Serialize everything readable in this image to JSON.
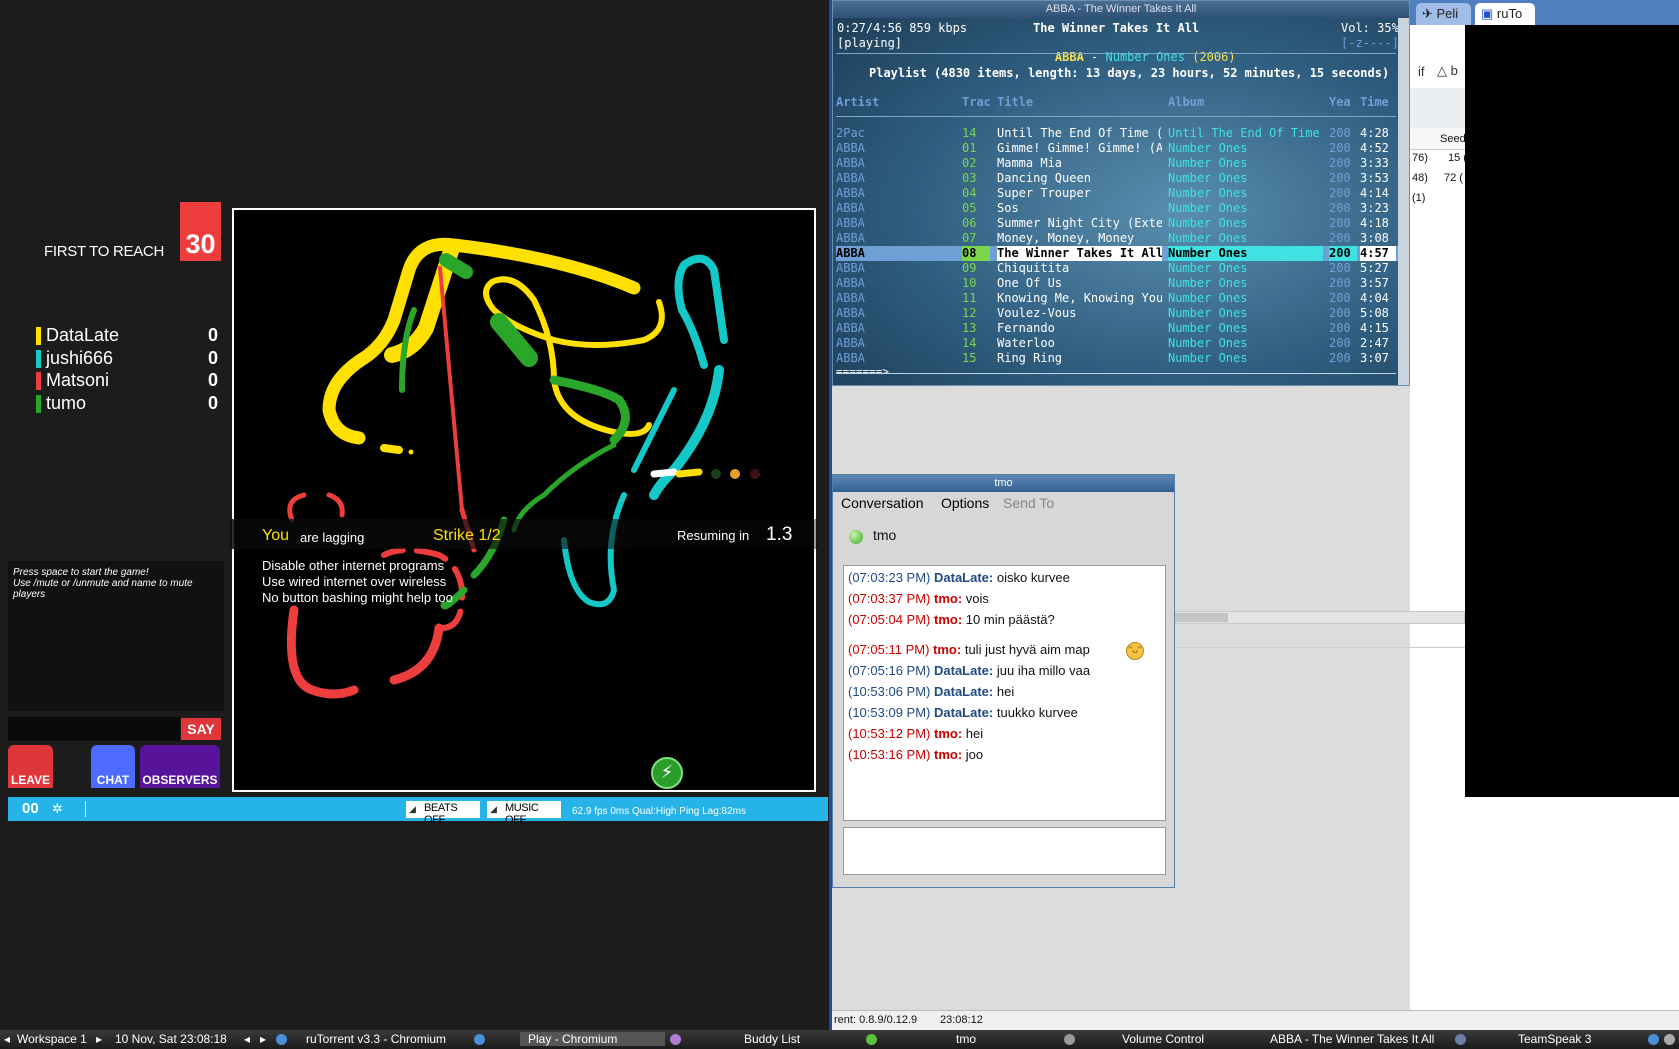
{
  "game": {
    "first_to_reach_label": "FIRST TO REACH",
    "first_to_reach_value": "30",
    "players": [
      {
        "name": "DataLate",
        "score": "0",
        "color": "#ffe000"
      },
      {
        "name": "jushi666",
        "score": "0",
        "color": "#14c8c8"
      },
      {
        "name": "Matsoni",
        "score": "0",
        "color": "#ee3d3d"
      },
      {
        "name": "tumo",
        "score": "0",
        "color": "#2aa62a"
      }
    ],
    "help_line1": "Press space to start the game!",
    "help_line2": "Use /mute or /unmute and name to mute players",
    "say_label": "SAY",
    "leave_label": "LEAVE",
    "chat_label": "CHAT",
    "observers_label": "OBSERVERS",
    "lag_you": "You",
    "lag_text": "are lagging",
    "strike": "Strike 1/2",
    "resuming_label": "Resuming in",
    "resuming_value": "1.3",
    "tips": [
      "Disable other internet programs",
      "Use wired internet over wireless",
      "No button bashing might help too"
    ],
    "status_count": "0",
    "status_count_b": "0",
    "beats_label": "BEATS OFF",
    "music_label": "MUSIC OFF",
    "fps_text": "62.9 fps 0ms Qual:High Ping Lag:82ms"
  },
  "player": {
    "window_title": "ABBA - The Winner Takes It All",
    "position": "0:27/4:56 859 kbps",
    "state": "[playing]",
    "now_title": "The Winner Takes It All",
    "now_artist": "ABBA",
    "now_sep": " - ",
    "now_album": "Number Ones",
    "now_year": "(2006)",
    "volume": "Vol: 35%",
    "flags": "[-z----]",
    "playlist_summary": "Playlist (4830 items, length: 13 days, 23 hours, 52 minutes, 15 seconds)",
    "headers": {
      "artist": "Artist",
      "track": "Trac",
      "title": "Title",
      "album": "Album",
      "year": "Yea",
      "time": "Time"
    },
    "rows": [
      {
        "artist": "2Pac",
        "track": "14",
        "title": "Until The End Of Time (",
        "album": "Until The End Of Time",
        "year": "200",
        "time": "4:28"
      },
      {
        "artist": "ABBA",
        "track": "01",
        "title": "Gimme! Gimme! Gimme! (A",
        "album": "Number Ones",
        "year": "200",
        "time": "4:52"
      },
      {
        "artist": "ABBA",
        "track": "02",
        "title": "Mamma Mia",
        "album": "Number Ones",
        "year": "200",
        "time": "3:33"
      },
      {
        "artist": "ABBA",
        "track": "03",
        "title": "Dancing Queen",
        "album": "Number Ones",
        "year": "200",
        "time": "3:53"
      },
      {
        "artist": "ABBA",
        "track": "04",
        "title": "Super Trouper",
        "album": "Number Ones",
        "year": "200",
        "time": "4:14"
      },
      {
        "artist": "ABBA",
        "track": "05",
        "title": "Sos",
        "album": "Number Ones",
        "year": "200",
        "time": "3:23"
      },
      {
        "artist": "ABBA",
        "track": "06",
        "title": "Summer Night City (Exte",
        "album": "Number Ones",
        "year": "200",
        "time": "4:18"
      },
      {
        "artist": "ABBA",
        "track": "07",
        "title": "Money, Money, Money",
        "album": "Number Ones",
        "year": "200",
        "time": "3:08"
      },
      {
        "artist": "ABBA",
        "track": "08",
        "title": "The Winner Takes It All",
        "album": "Number Ones",
        "year": "200",
        "time": "4:57"
      },
      {
        "artist": "ABBA",
        "track": "09",
        "title": "Chiquitita",
        "album": "Number Ones",
        "year": "200",
        "time": "5:27"
      },
      {
        "artist": "ABBA",
        "track": "10",
        "title": "One Of Us",
        "album": "Number Ones",
        "year": "200",
        "time": "3:57"
      },
      {
        "artist": "ABBA",
        "track": "11",
        "title": "Knowing Me, Knowing You",
        "album": "Number Ones",
        "year": "200",
        "time": "4:04"
      },
      {
        "artist": "ABBA",
        "track": "12",
        "title": "Voulez-Vous",
        "album": "Number Ones",
        "year": "200",
        "time": "5:08"
      },
      {
        "artist": "ABBA",
        "track": "13",
        "title": "Fernando",
        "album": "Number Ones",
        "year": "200",
        "time": "4:15"
      },
      {
        "artist": "ABBA",
        "track": "14",
        "title": "Waterloo",
        "album": "Number Ones",
        "year": "200",
        "time": "2:47"
      },
      {
        "artist": "ABBA",
        "track": "15",
        "title": "Ring Ring",
        "album": "Number Ones",
        "year": "200",
        "time": "3:07"
      }
    ],
    "selected_index": 8,
    "progress_text": "=======>"
  },
  "chrome": {
    "tab1": "Peli",
    "tab2": "ruTo"
  },
  "rutorrent": {
    "toolbar_if": "if",
    "toolbar_b": "b",
    "col_seeds": "Seed",
    "cells": [
      "76)",
      "15 (",
      "48)",
      "72 (",
      "(1)"
    ],
    "status_version": "rent: 0.8.9/0.12.9",
    "status_time": "23:08:12"
  },
  "chat": {
    "window_title": "tmo",
    "menu": [
      "Conversation",
      "Options",
      "Send To"
    ],
    "contact": "tmo",
    "messages": [
      {
        "ts": "(07:03:23 PM)",
        "name": "DataLate:",
        "text": "oisko kurvee",
        "who": "blue"
      },
      {
        "ts": "(07:03:37 PM)",
        "name": "tmo:",
        "text": "vois",
        "who": "red"
      },
      {
        "ts": "(07:05:04 PM)",
        "name": "tmo:",
        "text": "10 min päästä?",
        "who": "red"
      },
      {
        "ts": "(07:05:11 PM)",
        "name": "tmo:",
        "text": "tuli just hyvä aim map",
        "who": "red"
      },
      {
        "ts": "(07:05:16 PM)",
        "name": "DataLate:",
        "text": "juu iha millo vaa",
        "who": "blue"
      },
      {
        "ts": "(10:53:06 PM)",
        "name": "DataLate:",
        "text": "hei",
        "who": "blue"
      },
      {
        "ts": "(10:53:09 PM)",
        "name": "DataLate:",
        "text": "tuukko kurvee",
        "who": "blue"
      },
      {
        "ts": "(10:53:12 PM)",
        "name": "tmo:",
        "text": "hei",
        "who": "red"
      },
      {
        "ts": "(10:53:16 PM)",
        "name": "tmo:",
        "text": "joo",
        "who": "red"
      }
    ]
  },
  "taskbar": {
    "workspace": "Workspace 1",
    "clock": "10 Nov, Sat 23:08:18",
    "items": [
      "ruTorrent v3.3 - Chromium",
      "Play - Chromium",
      "Buddy List",
      "tmo",
      "Volume Control",
      "ABBA - The Winner Takes It All",
      "TeamSpeak 3"
    ]
  }
}
